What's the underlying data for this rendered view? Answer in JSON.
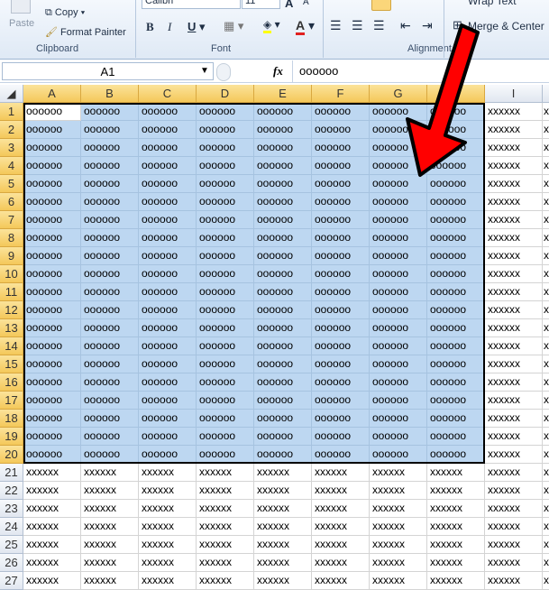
{
  "ribbon": {
    "paste": "Paste",
    "copy": "Copy",
    "format_painter": "Format Painter",
    "clipboard": "Clipboard",
    "font_name": "Calibri",
    "font_size": "11",
    "font": "Font",
    "bold": "B",
    "italic": "I",
    "underline": "U",
    "font_color": "A",
    "alignment": "Alignment",
    "wrap_text": "Wrap Text",
    "merge_center": "Merge & Center"
  },
  "formula_bar": {
    "name_box": "A1",
    "fx": "fx",
    "value": "oooooo"
  },
  "columns": [
    "A",
    "B",
    "C",
    "D",
    "E",
    "F",
    "G",
    "H",
    "I",
    ""
  ],
  "selection": {
    "range": "A1:H20",
    "color": "#bdd7f1"
  },
  "annotation": {
    "arrow_color": "#ff0000"
  },
  "rows": [
    [
      "oooooo",
      "oooooo",
      "oooooo",
      "oooooo",
      "oooooo",
      "oooooo",
      "oooooo",
      "oooooo",
      "xxxxxx",
      "x"
    ],
    [
      "oooooo",
      "oooooo",
      "oooooo",
      "oooooo",
      "oooooo",
      "oooooo",
      "oooooo",
      "oooooo",
      "xxxxxx",
      "x"
    ],
    [
      "oooooo",
      "oooooo",
      "oooooo",
      "oooooo",
      "oooooo",
      "oooooo",
      "oooooo",
      "oooooo",
      "xxxxxx",
      "x"
    ],
    [
      "oooooo",
      "oooooo",
      "oooooo",
      "oooooo",
      "oooooo",
      "oooooo",
      "oooooo",
      "oooooo",
      "xxxxxx",
      "x"
    ],
    [
      "oooooo",
      "oooooo",
      "oooooo",
      "oooooo",
      "oooooo",
      "oooooo",
      "oooooo",
      "oooooo",
      "xxxxxx",
      "x"
    ],
    [
      "oooooo",
      "oooooo",
      "oooooo",
      "oooooo",
      "oooooo",
      "oooooo",
      "oooooo",
      "oooooo",
      "xxxxxx",
      "x"
    ],
    [
      "oooooo",
      "oooooo",
      "oooooo",
      "oooooo",
      "oooooo",
      "oooooo",
      "oooooo",
      "oooooo",
      "xxxxxx",
      "x"
    ],
    [
      "oooooo",
      "oooooo",
      "oooooo",
      "oooooo",
      "oooooo",
      "oooooo",
      "oooooo",
      "oooooo",
      "xxxxxx",
      "x"
    ],
    [
      "oooooo",
      "oooooo",
      "oooooo",
      "oooooo",
      "oooooo",
      "oooooo",
      "oooooo",
      "oooooo",
      "xxxxxx",
      "x"
    ],
    [
      "oooooo",
      "oooooo",
      "oooooo",
      "oooooo",
      "oooooo",
      "oooooo",
      "oooooo",
      "oooooo",
      "xxxxxx",
      "x"
    ],
    [
      "oooooo",
      "oooooo",
      "oooooo",
      "oooooo",
      "oooooo",
      "oooooo",
      "oooooo",
      "oooooo",
      "xxxxxx",
      "x"
    ],
    [
      "oooooo",
      "oooooo",
      "oooooo",
      "oooooo",
      "oooooo",
      "oooooo",
      "oooooo",
      "oooooo",
      "xxxxxx",
      "x"
    ],
    [
      "oooooo",
      "oooooo",
      "oooooo",
      "oooooo",
      "oooooo",
      "oooooo",
      "oooooo",
      "oooooo",
      "xxxxxx",
      "x"
    ],
    [
      "oooooo",
      "oooooo",
      "oooooo",
      "oooooo",
      "oooooo",
      "oooooo",
      "oooooo",
      "oooooo",
      "xxxxxx",
      "x"
    ],
    [
      "oooooo",
      "oooooo",
      "oooooo",
      "oooooo",
      "oooooo",
      "oooooo",
      "oooooo",
      "oooooo",
      "xxxxxx",
      "x"
    ],
    [
      "oooooo",
      "oooooo",
      "oooooo",
      "oooooo",
      "oooooo",
      "oooooo",
      "oooooo",
      "oooooo",
      "xxxxxx",
      "x"
    ],
    [
      "oooooo",
      "oooooo",
      "oooooo",
      "oooooo",
      "oooooo",
      "oooooo",
      "oooooo",
      "oooooo",
      "xxxxxx",
      "x"
    ],
    [
      "oooooo",
      "oooooo",
      "oooooo",
      "oooooo",
      "oooooo",
      "oooooo",
      "oooooo",
      "oooooo",
      "xxxxxx",
      "x"
    ],
    [
      "oooooo",
      "oooooo",
      "oooooo",
      "oooooo",
      "oooooo",
      "oooooo",
      "oooooo",
      "oooooo",
      "xxxxxx",
      "x"
    ],
    [
      "oooooo",
      "oooooo",
      "oooooo",
      "oooooo",
      "oooooo",
      "oooooo",
      "oooooo",
      "oooooo",
      "xxxxxx",
      "x"
    ],
    [
      "xxxxxx",
      "xxxxxx",
      "xxxxxx",
      "xxxxxx",
      "xxxxxx",
      "xxxxxx",
      "xxxxxx",
      "xxxxxx",
      "xxxxxx",
      "x"
    ],
    [
      "xxxxxx",
      "xxxxxx",
      "xxxxxx",
      "xxxxxx",
      "xxxxxx",
      "xxxxxx",
      "xxxxxx",
      "xxxxxx",
      "xxxxxx",
      "x"
    ],
    [
      "xxxxxx",
      "xxxxxx",
      "xxxxxx",
      "xxxxxx",
      "xxxxxx",
      "xxxxxx",
      "xxxxxx",
      "xxxxxx",
      "xxxxxx",
      "x"
    ],
    [
      "xxxxxx",
      "xxxxxx",
      "xxxxxx",
      "xxxxxx",
      "xxxxxx",
      "xxxxxx",
      "xxxxxx",
      "xxxxxx",
      "xxxxxx",
      "x"
    ],
    [
      "xxxxxx",
      "xxxxxx",
      "xxxxxx",
      "xxxxxx",
      "xxxxxx",
      "xxxxxx",
      "xxxxxx",
      "xxxxxx",
      "xxxxxx",
      "x"
    ],
    [
      "xxxxxx",
      "xxxxxx",
      "xxxxxx",
      "xxxxxx",
      "xxxxxx",
      "xxxxxx",
      "xxxxxx",
      "xxxxxx",
      "xxxxxx",
      "x"
    ],
    [
      "xxxxxx",
      "xxxxxx",
      "xxxxxx",
      "xxxxxx",
      "xxxxxx",
      "xxxxxx",
      "xxxxxx",
      "xxxxxx",
      "xxxxxx",
      "x"
    ]
  ]
}
